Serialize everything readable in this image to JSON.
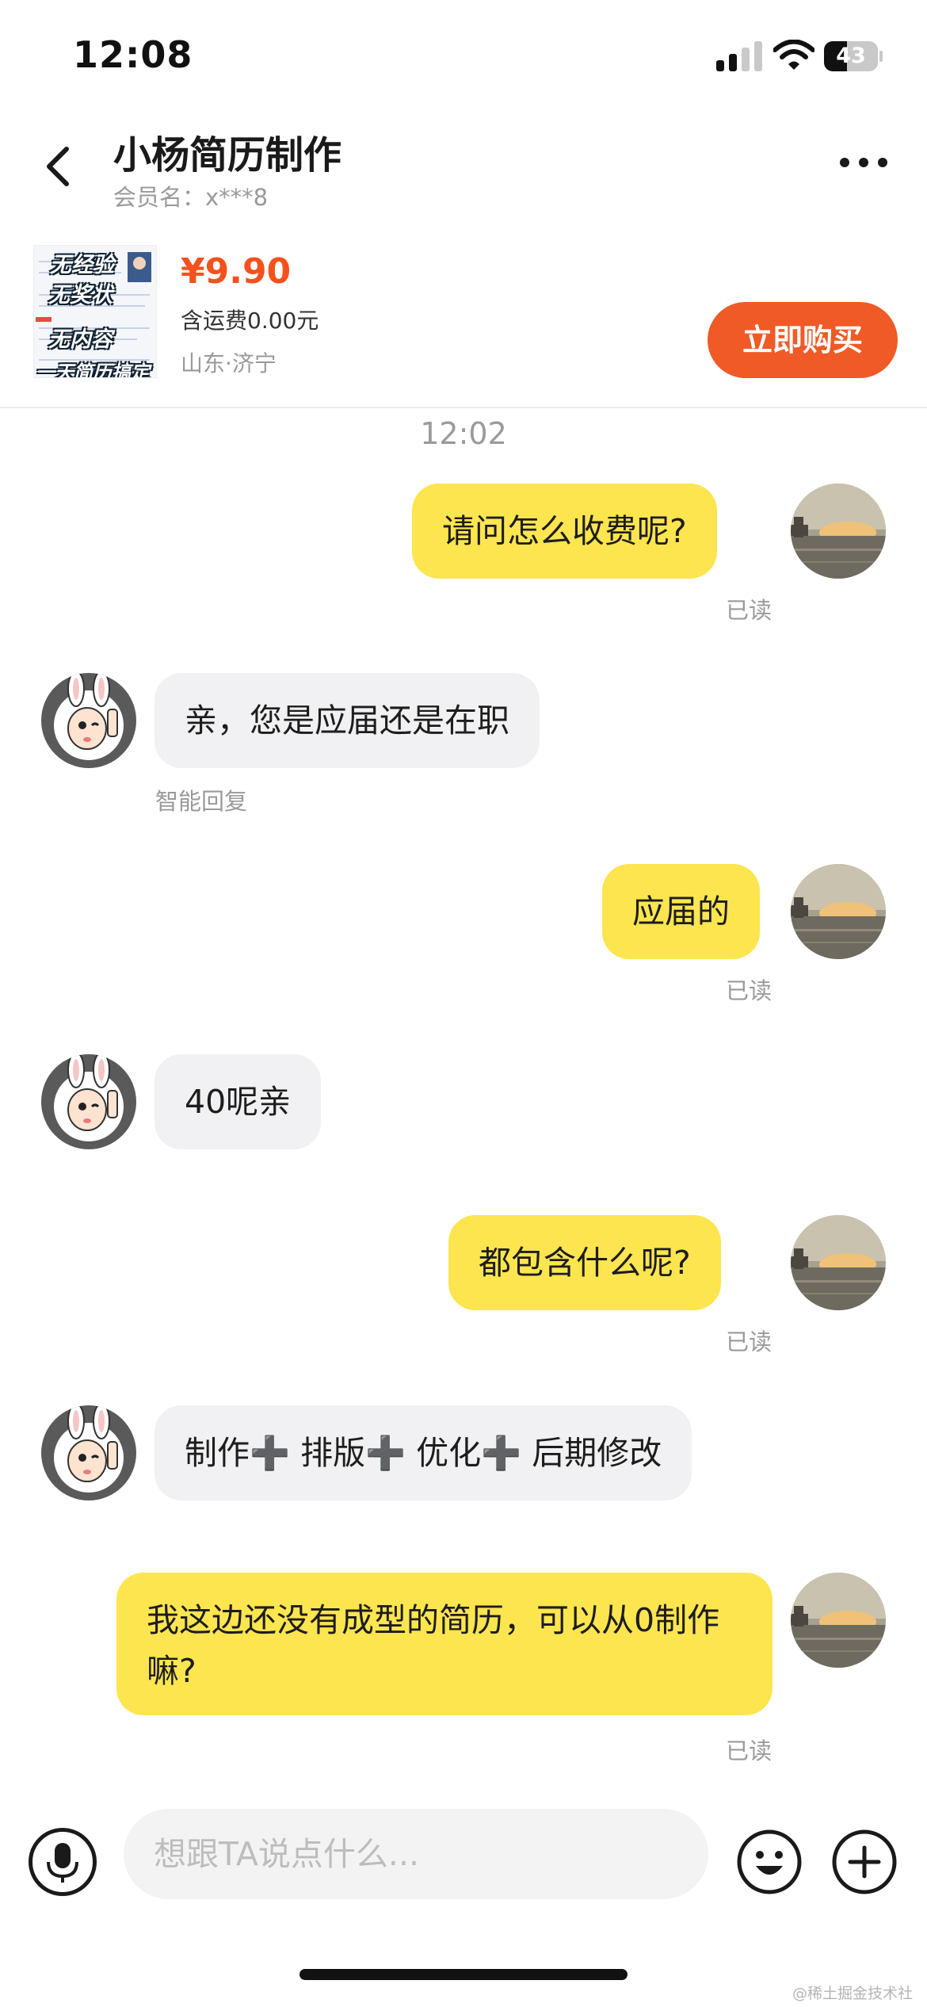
{
  "status_bar": {
    "time": "12:08",
    "battery": "43",
    "battery_level": 0.43
  },
  "header": {
    "title": "小杨简历制作",
    "member_label": "会员名：x***8"
  },
  "product": {
    "thumb_lines": [
      "无经验",
      "无奖状",
      "无内容",
      "一天简历搞定"
    ],
    "price": "¥9.90",
    "shipping": "含运费0.00元",
    "location": "山东·济宁",
    "buy_label": "立即购买"
  },
  "chat": {
    "time": "12:02",
    "messages": [
      {
        "from": "me",
        "text": "请问怎么收费呢?",
        "status": "已读"
      },
      {
        "from": "seller",
        "text": "亲，您是应届还是在职",
        "note": "智能回复"
      },
      {
        "from": "me",
        "text": "应届的",
        "status": "已读"
      },
      {
        "from": "seller",
        "text": "40呢亲"
      },
      {
        "from": "me",
        "text": "都包含什么呢?",
        "status": "已读"
      },
      {
        "from": "seller",
        "text": "制作➕ 排版➕ 优化➕ 后期修改"
      },
      {
        "from": "me",
        "text": "我这边还没有成型的简历，可以从0制作嘛?",
        "status": "已读"
      }
    ]
  },
  "input": {
    "placeholder": "想跟TA说点什么..."
  },
  "watermark": "@稀土掘金技术社区",
  "colors": {
    "accent": "#ef5a27",
    "price": "#f4511e",
    "my_bubble": "#fde54f",
    "their_bubble": "#f1f1f3"
  }
}
